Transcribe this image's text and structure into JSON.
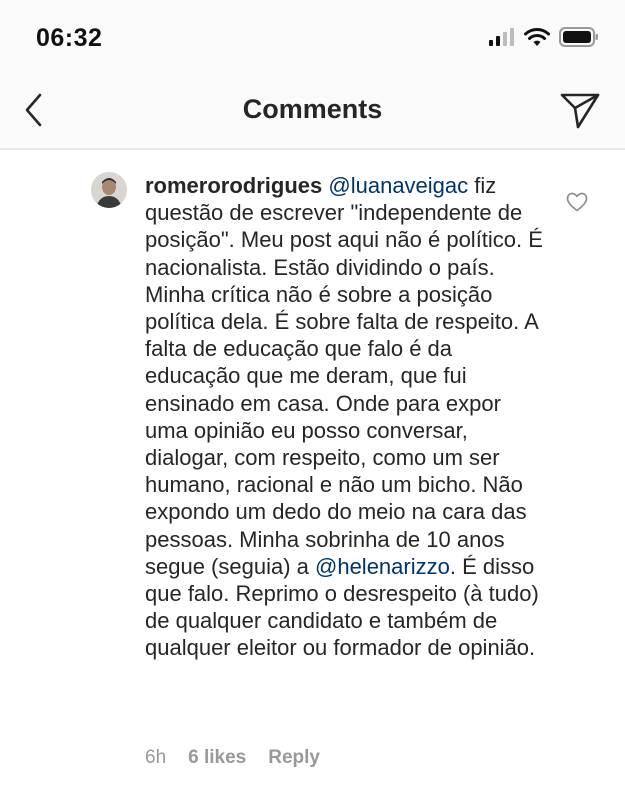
{
  "status": {
    "time": "06:32"
  },
  "header": {
    "title": "Comments",
    "back_icon": "chevron-left-icon",
    "share_icon": "paper-plane-icon"
  },
  "comment": {
    "username": "romerorodrigues",
    "mention1": "@luanaveigac",
    "text1": " fiz questão de escrever \"independente de posição\". Meu post aqui não é político. É nacionalista. Estão dividindo o país. Minha crítica não é sobre a posição política dela. É sobre falta de respeito. A falta de educação que falo é da educação que me deram, que fui ensinado em casa. Onde para expor uma opinião eu posso conversar, dialogar, com respeito, como um ser humano, racional e não um bicho. Não expondo um dedo do meio na cara das pessoas. Minha sobrinha de 10 anos segue (seguia) a ",
    "mention2": "@helenarizzo",
    "text2": ". É disso que falo. Reprimo o desrespeito (à tudo) de qualquer candidato e também de qualquer eleitor ou formador de opinião.",
    "time_ago": "6h",
    "likes": "6 likes",
    "reply_label": "Reply",
    "heart_icon": "heart-outline-icon"
  },
  "colors": {
    "mention": "#003569",
    "meta": "#999999",
    "text": "#262626"
  }
}
